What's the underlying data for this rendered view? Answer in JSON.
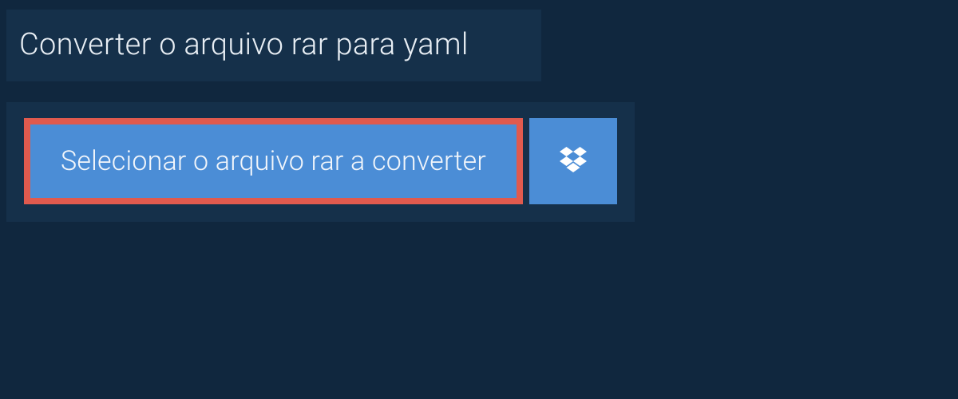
{
  "header": {
    "title": "Converter o arquivo rar para yaml"
  },
  "actions": {
    "select_label": "Selecionar o arquivo rar a converter"
  },
  "colors": {
    "page_bg": "#10273e",
    "panel_bg": "#15304a",
    "button_bg": "#4b8dd6",
    "highlight_border": "#e05a4e",
    "text": "#e8eef4"
  }
}
